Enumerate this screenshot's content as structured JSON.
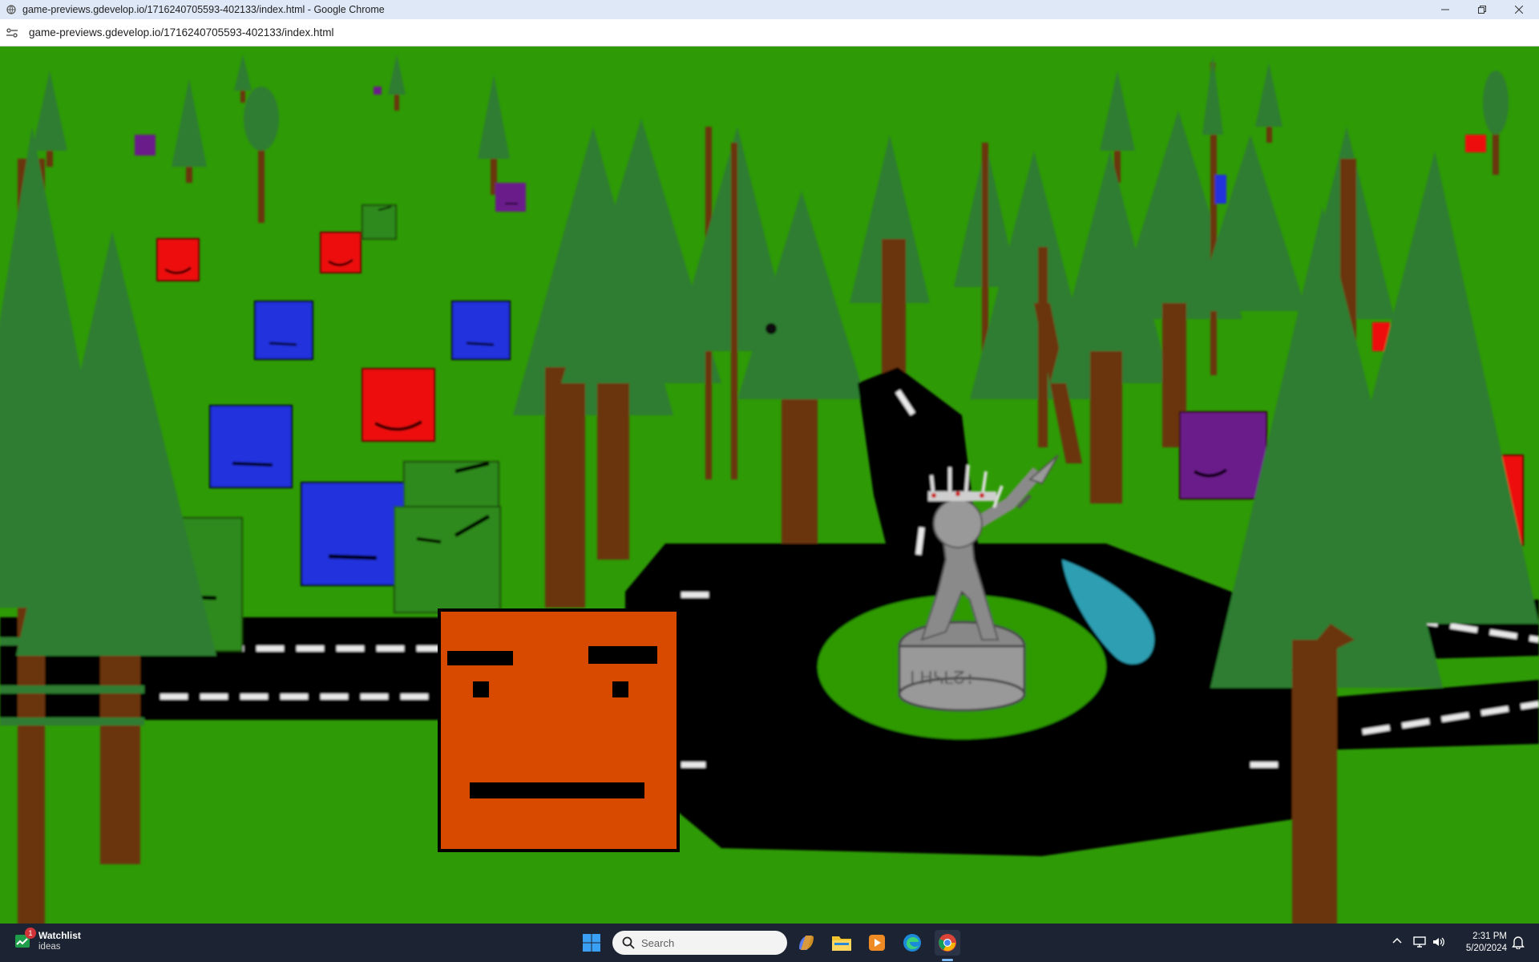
{
  "window": {
    "title": "game-previews.gdevelop.io/1716240705593-402133/index.html - Google Chrome",
    "controls": [
      "minimize-icon",
      "restore-icon",
      "close-icon"
    ]
  },
  "address_bar": {
    "url": "game-previews.gdevelop.io/1716240705593-402133/index.html",
    "site_info_icon": "site-info-icon"
  },
  "game": {
    "background_color": "#2e9a06",
    "tree_color": "#2f7d32",
    "trunk_color": "#6b3410",
    "road_color": "#000000",
    "player_color": "#d84a00",
    "blue_square_color": "#2233dd",
    "red_square_color": "#ee1111",
    "green_square_color": "#2f8a1a",
    "purple_square_color": "#6a1a8a",
    "statue_color": "#888888",
    "pond_color": "#2d9fb2"
  },
  "taskbar": {
    "widget": {
      "title": "Watchlist",
      "subtitle": "ideas",
      "badge": "1"
    },
    "search": {
      "placeholder": "Search"
    },
    "apps": [
      "windows-start-icon",
      "copilot-icon",
      "file-explorer-icon",
      "media-player-icon",
      "edge-icon",
      "chrome-icon"
    ],
    "clock": {
      "time": "2:31 PM",
      "date": "5/20/2024"
    }
  }
}
